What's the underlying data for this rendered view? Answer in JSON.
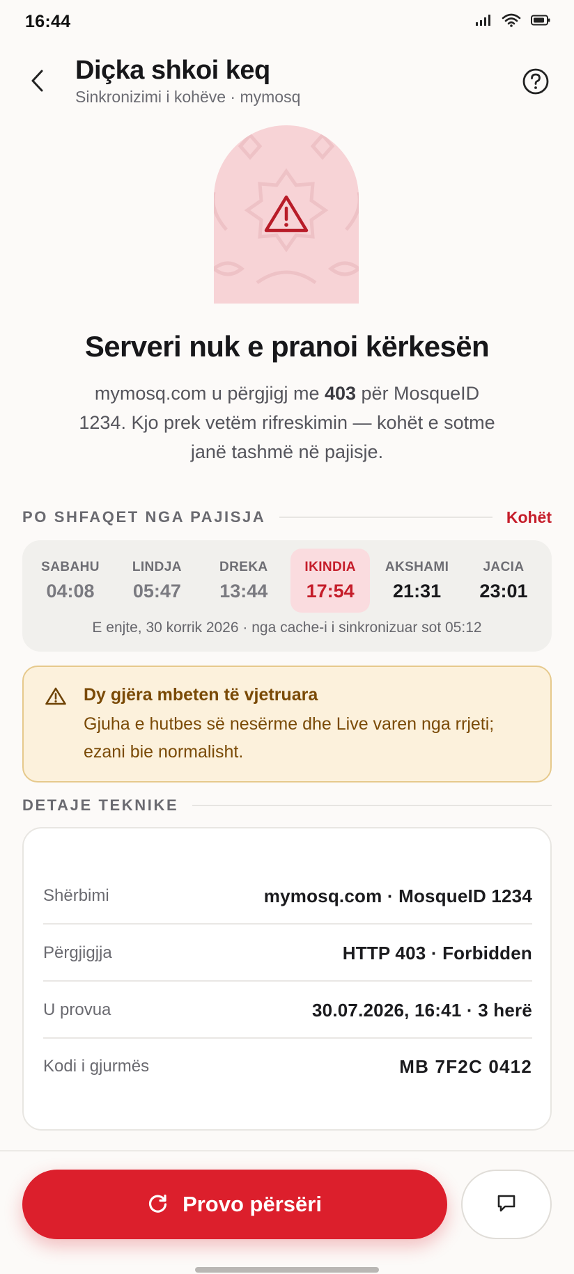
{
  "status_bar": {
    "time": "16:44",
    "icons": [
      "signal-icon",
      "wifi-icon",
      "battery-icon"
    ]
  },
  "header": {
    "title": "Diçka shkoi keq",
    "subtitle": "Sinkronizimi i kohëve · mymosq",
    "back_icon": "chevron-left-icon",
    "help_icon": "help-circle-icon"
  },
  "error": {
    "icon": "warning-triangle-icon",
    "title": "Serveri nuk e pranoi kërkesën",
    "desc_before": "mymosq.com u përgjigj me ",
    "desc_code": "403",
    "desc_after": " për MosqueID 1234. Kjo prek vetëm rifreskimin — kohët e sotme janë tashmë në pajisje."
  },
  "device_times": {
    "section_label": "PO SHFAQET NGA PAJISJA",
    "link_label": "Kohët",
    "times": [
      {
        "name": "SABAHU",
        "time": "04:08"
      },
      {
        "name": "LINDJA",
        "time": "05:47"
      },
      {
        "name": "DREKA",
        "time": "13:44"
      },
      {
        "name": "IKINDIA",
        "time": "17:54"
      },
      {
        "name": "AKSHAMI",
        "time": "21:31"
      },
      {
        "name": "JACIA",
        "time": "23:01"
      }
    ],
    "footer": "E enjte, 30 korrik 2026 · nga cache-i i sinkronizuar sot 05:12"
  },
  "notice": {
    "icon": "warning-triangle-icon",
    "title": "Dy gjëra mbeten të vjetruara",
    "body": "Gjuha e hutbes së nesërme dhe Live varen nga rrjeti; ezani bie normalisht."
  },
  "details": {
    "section_label": "DETAJE TEKNIKE",
    "rows": [
      {
        "label": "Shërbimi",
        "value": "mymosq.com · MosqueID 1234"
      },
      {
        "label": "Përgjigjja",
        "value": "HTTP 403 · Forbidden"
      },
      {
        "label": "U provua",
        "value": "30.07.2026, 16:41 · 3 herë"
      },
      {
        "label": "Kodi i gjurmës",
        "value": "MB 7F2C 0412"
      }
    ]
  },
  "actions": {
    "retry_label": "Provo përsëri",
    "retry_icon": "refresh-icon",
    "feedback_icon": "message-icon"
  },
  "colors": {
    "accent": "#dc1f2c",
    "accent_text": "#c51d2a",
    "warning_bg": "#fcf1dc",
    "warning_text": "#7a4a06",
    "arch_bg": "#f7d3d6"
  }
}
